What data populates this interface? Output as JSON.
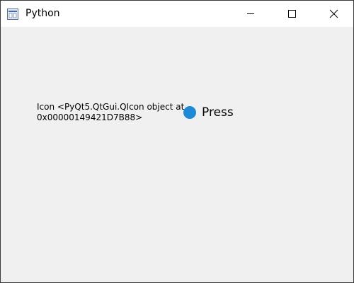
{
  "window": {
    "title": "Python",
    "app_icon": "python-window-icon"
  },
  "caption_buttons": {
    "minimize_icon": "minimize-icon",
    "maximize_icon": "maximize-icon",
    "close_icon": "close-icon"
  },
  "content": {
    "icon_label": "Icon <PyQt5.QtGui.QIcon object at\n0x00000149421D7B88>",
    "press_button": {
      "label": "Press",
      "icon": "blue-circle-icon",
      "icon_color": "#1e8ad6"
    }
  }
}
